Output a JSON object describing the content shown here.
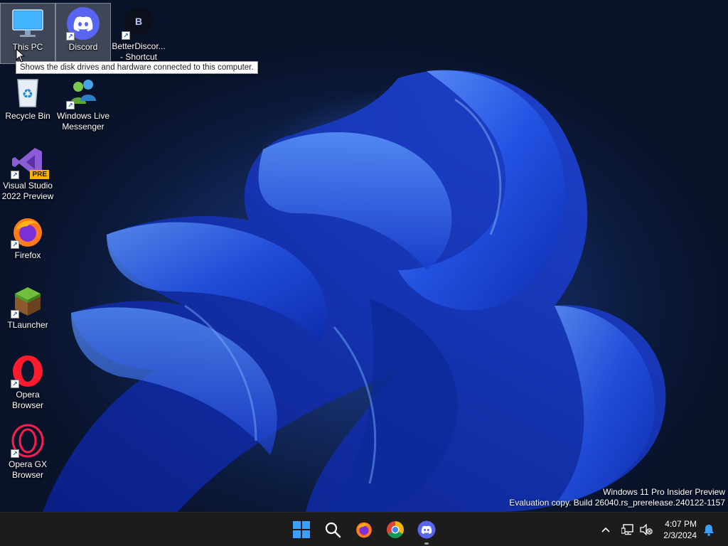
{
  "desktop": {
    "icons": [
      {
        "label": "This PC",
        "icon": "monitor-icon"
      },
      {
        "label": "Discord",
        "icon": "discord-icon"
      },
      {
        "label": "BetterDiscor...\n- Shortcut",
        "icon": "betterdiscord-icon"
      },
      {
        "label": "Recycle Bin",
        "icon": "recycle-bin-icon"
      },
      {
        "label": "Windows Live\nMessenger",
        "icon": "messenger-icon"
      },
      {
        "label": "Visual Studio\n2022 Preview",
        "icon": "visual-studio-icon",
        "badge": "PRE"
      },
      {
        "label": "Firefox",
        "icon": "firefox-icon"
      },
      {
        "label": "TLauncher",
        "icon": "grass-block-icon"
      },
      {
        "label": "Opera\nBrowser",
        "icon": "opera-icon"
      },
      {
        "label": "Opera GX\nBrowser",
        "icon": "opera-gx-icon"
      }
    ],
    "tooltip": "Shows the disk drives and hardware connected to this computer.",
    "watermark": {
      "line1": "Windows 11 Pro Insider Preview",
      "line2": "Evaluation copy. Build 26040.rs_prerelease.240122-1157"
    }
  },
  "taskbar": {
    "pinned": [
      "start-icon",
      "search-icon",
      "firefox-icon",
      "chrome-icon",
      "discord-icon"
    ],
    "tray": [
      "chevron-up-icon",
      "network-icon",
      "volume-muted-icon"
    ],
    "time": "4:07 PM",
    "date": "2/3/2024",
    "notification": "bell-icon"
  },
  "colors": {
    "taskbar": "#1c1c1c",
    "accent": "#0078d4",
    "discord": "#5865f2",
    "opera": "#ff1b2d"
  }
}
